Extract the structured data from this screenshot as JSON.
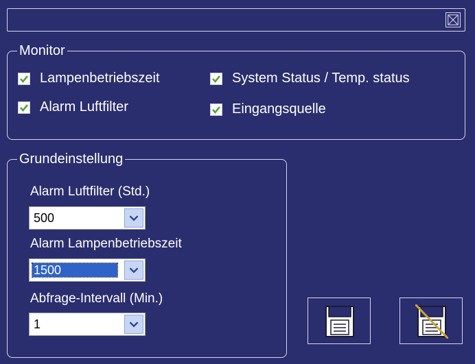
{
  "titlebar": {
    "close_icon": "close-x-box-icon"
  },
  "monitor": {
    "legend": "Monitor",
    "items": [
      {
        "label": "Lampenbetriebszeit",
        "checked": true
      },
      {
        "label": "System Status / Temp. status",
        "checked": true
      },
      {
        "label": "Alarm Luftfilter",
        "checked": true
      },
      {
        "label": "Eingangsquelle",
        "checked": true
      }
    ]
  },
  "grundeinstellung": {
    "legend": "Grundeinstellung",
    "fields": [
      {
        "label": "Alarm Luftfilter (Std.)",
        "value": "500",
        "focused": false
      },
      {
        "label": "Alarm Lampenbetriebszeit",
        "value": "1500",
        "focused": true
      },
      {
        "label": "Abfrage-Intervall (Min.)",
        "value": "1",
        "focused": false
      }
    ]
  },
  "buttons": {
    "save_icon": "floppy-disk-icon",
    "no_save_icon": "floppy-disk-crossed-icon"
  },
  "colors": {
    "background": "#2a2d6e",
    "check": "#5aa33a",
    "selection": "#2f63c9",
    "cross_line": "#c8a43a"
  }
}
